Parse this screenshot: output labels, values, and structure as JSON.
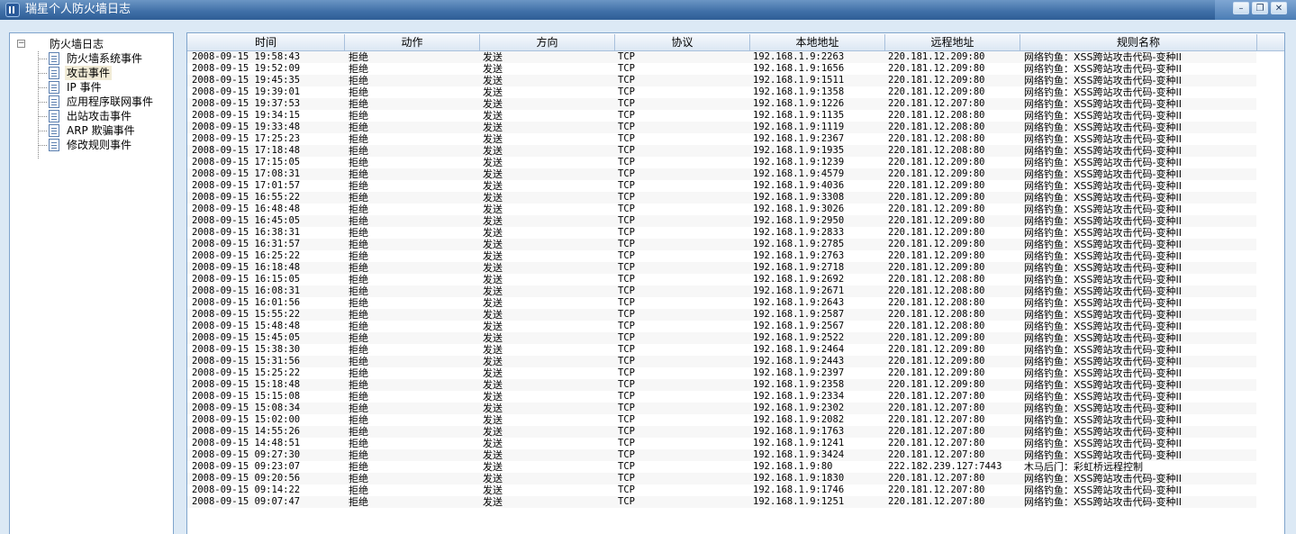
{
  "window": {
    "title": "瑞星个人防火墙日志"
  },
  "tree": {
    "root": "防火墙日志",
    "items": [
      "防火墙系统事件",
      "攻击事件",
      "IP 事件",
      "应用程序联网事件",
      "出站攻击事件",
      "ARP 欺骗事件",
      "修改规则事件"
    ],
    "selected_index": 1
  },
  "table": {
    "headers": [
      "时间",
      "动作",
      "方向",
      "协议",
      "本地地址",
      "远程地址",
      "规则名称"
    ],
    "rows": [
      [
        "2008-09-15 19:58:43",
        "拒绝",
        "发送",
        "TCP",
        "192.168.1.9:2263",
        "220.181.12.209:80",
        "网络钓鱼：XSS跨站攻击代码-变种II"
      ],
      [
        "2008-09-15 19:52:09",
        "拒绝",
        "发送",
        "TCP",
        "192.168.1.9:1656",
        "220.181.12.209:80",
        "网络钓鱼：XSS跨站攻击代码-变种II"
      ],
      [
        "2008-09-15 19:45:35",
        "拒绝",
        "发送",
        "TCP",
        "192.168.1.9:1511",
        "220.181.12.209:80",
        "网络钓鱼：XSS跨站攻击代码-变种II"
      ],
      [
        "2008-09-15 19:39:01",
        "拒绝",
        "发送",
        "TCP",
        "192.168.1.9:1358",
        "220.181.12.209:80",
        "网络钓鱼：XSS跨站攻击代码-变种II"
      ],
      [
        "2008-09-15 19:37:53",
        "拒绝",
        "发送",
        "TCP",
        "192.168.1.9:1226",
        "220.181.12.207:80",
        "网络钓鱼：XSS跨站攻击代码-变种II"
      ],
      [
        "2008-09-15 19:34:15",
        "拒绝",
        "发送",
        "TCP",
        "192.168.1.9:1135",
        "220.181.12.208:80",
        "网络钓鱼：XSS跨站攻击代码-变种II"
      ],
      [
        "2008-09-15 19:33:48",
        "拒绝",
        "发送",
        "TCP",
        "192.168.1.9:1119",
        "220.181.12.208:80",
        "网络钓鱼：XSS跨站攻击代码-变种II"
      ],
      [
        "2008-09-15 17:25:23",
        "拒绝",
        "发送",
        "TCP",
        "192.168.1.9:2367",
        "220.181.12.208:80",
        "网络钓鱼：XSS跨站攻击代码-变种II"
      ],
      [
        "2008-09-15 17:18:48",
        "拒绝",
        "发送",
        "TCP",
        "192.168.1.9:1935",
        "220.181.12.208:80",
        "网络钓鱼：XSS跨站攻击代码-变种II"
      ],
      [
        "2008-09-15 17:15:05",
        "拒绝",
        "发送",
        "TCP",
        "192.168.1.9:1239",
        "220.181.12.209:80",
        "网络钓鱼：XSS跨站攻击代码-变种II"
      ],
      [
        "2008-09-15 17:08:31",
        "拒绝",
        "发送",
        "TCP",
        "192.168.1.9:4579",
        "220.181.12.209:80",
        "网络钓鱼：XSS跨站攻击代码-变种II"
      ],
      [
        "2008-09-15 17:01:57",
        "拒绝",
        "发送",
        "TCP",
        "192.168.1.9:4036",
        "220.181.12.209:80",
        "网络钓鱼：XSS跨站攻击代码-变种II"
      ],
      [
        "2008-09-15 16:55:22",
        "拒绝",
        "发送",
        "TCP",
        "192.168.1.9:3308",
        "220.181.12.209:80",
        "网络钓鱼：XSS跨站攻击代码-变种II"
      ],
      [
        "2008-09-15 16:48:48",
        "拒绝",
        "发送",
        "TCP",
        "192.168.1.9:3026",
        "220.181.12.209:80",
        "网络钓鱼：XSS跨站攻击代码-变种II"
      ],
      [
        "2008-09-15 16:45:05",
        "拒绝",
        "发送",
        "TCP",
        "192.168.1.9:2950",
        "220.181.12.209:80",
        "网络钓鱼：XSS跨站攻击代码-变种II"
      ],
      [
        "2008-09-15 16:38:31",
        "拒绝",
        "发送",
        "TCP",
        "192.168.1.9:2833",
        "220.181.12.209:80",
        "网络钓鱼：XSS跨站攻击代码-变种II"
      ],
      [
        "2008-09-15 16:31:57",
        "拒绝",
        "发送",
        "TCP",
        "192.168.1.9:2785",
        "220.181.12.209:80",
        "网络钓鱼：XSS跨站攻击代码-变种II"
      ],
      [
        "2008-09-15 16:25:22",
        "拒绝",
        "发送",
        "TCP",
        "192.168.1.9:2763",
        "220.181.12.209:80",
        "网络钓鱼：XSS跨站攻击代码-变种II"
      ],
      [
        "2008-09-15 16:18:48",
        "拒绝",
        "发送",
        "TCP",
        "192.168.1.9:2718",
        "220.181.12.209:80",
        "网络钓鱼：XSS跨站攻击代码-变种II"
      ],
      [
        "2008-09-15 16:15:05",
        "拒绝",
        "发送",
        "TCP",
        "192.168.1.9:2692",
        "220.181.12.208:80",
        "网络钓鱼：XSS跨站攻击代码-变种II"
      ],
      [
        "2008-09-15 16:08:31",
        "拒绝",
        "发送",
        "TCP",
        "192.168.1.9:2671",
        "220.181.12.208:80",
        "网络钓鱼：XSS跨站攻击代码-变种II"
      ],
      [
        "2008-09-15 16:01:56",
        "拒绝",
        "发送",
        "TCP",
        "192.168.1.9:2643",
        "220.181.12.208:80",
        "网络钓鱼：XSS跨站攻击代码-变种II"
      ],
      [
        "2008-09-15 15:55:22",
        "拒绝",
        "发送",
        "TCP",
        "192.168.1.9:2587",
        "220.181.12.208:80",
        "网络钓鱼：XSS跨站攻击代码-变种II"
      ],
      [
        "2008-09-15 15:48:48",
        "拒绝",
        "发送",
        "TCP",
        "192.168.1.9:2567",
        "220.181.12.208:80",
        "网络钓鱼：XSS跨站攻击代码-变种II"
      ],
      [
        "2008-09-15 15:45:05",
        "拒绝",
        "发送",
        "TCP",
        "192.168.1.9:2522",
        "220.181.12.209:80",
        "网络钓鱼：XSS跨站攻击代码-变种II"
      ],
      [
        "2008-09-15 15:38:30",
        "拒绝",
        "发送",
        "TCP",
        "192.168.1.9:2464",
        "220.181.12.209:80",
        "网络钓鱼：XSS跨站攻击代码-变种II"
      ],
      [
        "2008-09-15 15:31:56",
        "拒绝",
        "发送",
        "TCP",
        "192.168.1.9:2443",
        "220.181.12.209:80",
        "网络钓鱼：XSS跨站攻击代码-变种II"
      ],
      [
        "2008-09-15 15:25:22",
        "拒绝",
        "发送",
        "TCP",
        "192.168.1.9:2397",
        "220.181.12.209:80",
        "网络钓鱼：XSS跨站攻击代码-变种II"
      ],
      [
        "2008-09-15 15:18:48",
        "拒绝",
        "发送",
        "TCP",
        "192.168.1.9:2358",
        "220.181.12.209:80",
        "网络钓鱼：XSS跨站攻击代码-变种II"
      ],
      [
        "2008-09-15 15:15:08",
        "拒绝",
        "发送",
        "TCP",
        "192.168.1.9:2334",
        "220.181.12.207:80",
        "网络钓鱼：XSS跨站攻击代码-变种II"
      ],
      [
        "2008-09-15 15:08:34",
        "拒绝",
        "发送",
        "TCP",
        "192.168.1.9:2302",
        "220.181.12.207:80",
        "网络钓鱼：XSS跨站攻击代码-变种II"
      ],
      [
        "2008-09-15 15:02:00",
        "拒绝",
        "发送",
        "TCP",
        "192.168.1.9:2082",
        "220.181.12.207:80",
        "网络钓鱼：XSS跨站攻击代码-变种II"
      ],
      [
        "2008-09-15 14:55:26",
        "拒绝",
        "发送",
        "TCP",
        "192.168.1.9:1763",
        "220.181.12.207:80",
        "网络钓鱼：XSS跨站攻击代码-变种II"
      ],
      [
        "2008-09-15 14:48:51",
        "拒绝",
        "发送",
        "TCP",
        "192.168.1.9:1241",
        "220.181.12.207:80",
        "网络钓鱼：XSS跨站攻击代码-变种II"
      ],
      [
        "2008-09-15 09:27:30",
        "拒绝",
        "发送",
        "TCP",
        "192.168.1.9:3424",
        "220.181.12.207:80",
        "网络钓鱼：XSS跨站攻击代码-变种II"
      ],
      [
        "2008-09-15 09:23:07",
        "拒绝",
        "发送",
        "TCP",
        "192.168.1.9:80",
        "222.182.239.127:7443",
        "木马后门：彩虹桥远程控制"
      ],
      [
        "2008-09-15 09:20:56",
        "拒绝",
        "发送",
        "TCP",
        "192.168.1.9:1830",
        "220.181.12.207:80",
        "网络钓鱼：XSS跨站攻击代码-变种II"
      ],
      [
        "2008-09-15 09:14:22",
        "拒绝",
        "发送",
        "TCP",
        "192.168.1.9:1746",
        "220.181.12.207:80",
        "网络钓鱼：XSS跨站攻击代码-变种II"
      ],
      [
        "2008-09-15 09:07:47",
        "拒绝",
        "发送",
        "TCP",
        "192.168.1.9:1251",
        "220.181.12.207:80",
        "网络钓鱼：XSS跨站攻击代码-变种II"
      ]
    ]
  }
}
